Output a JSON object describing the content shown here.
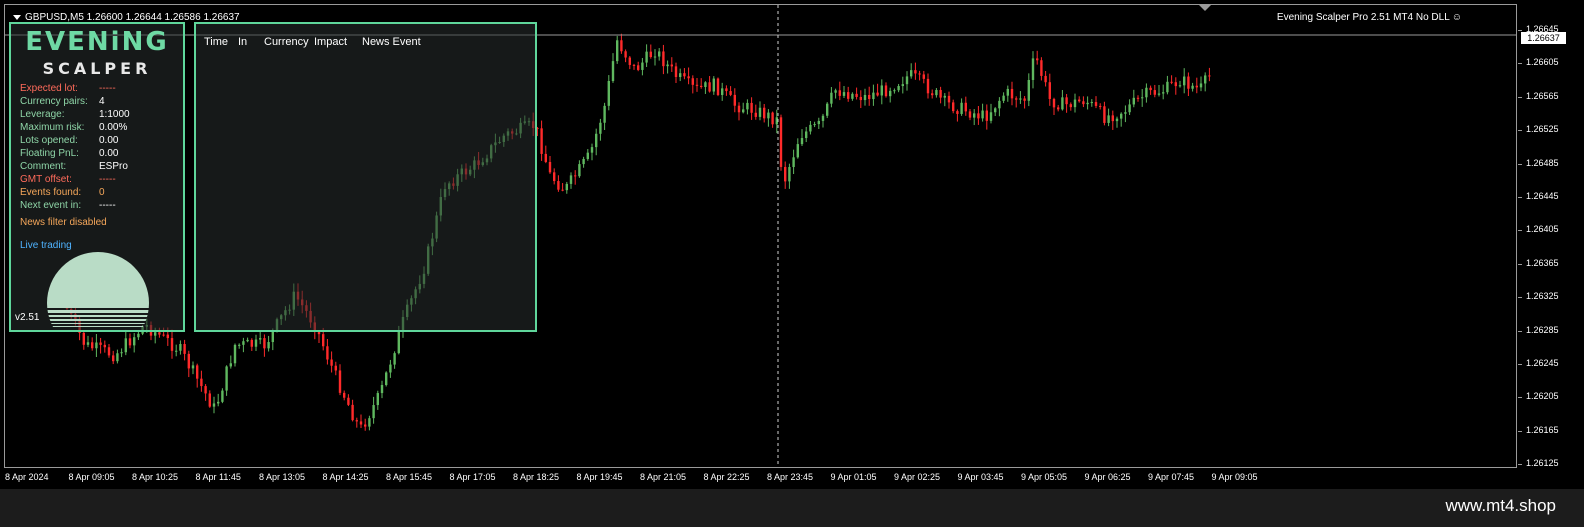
{
  "chart": {
    "symbol_info": "GBPUSD,M5  1.26600 1.26644 1.26586 1.26637",
    "ea_label": "Evening Scalper Pro 2.51 MT4 No DLL",
    "smiley": "☺",
    "current_price": "1.26637",
    "price_ticks": [
      "1.26645",
      "1.26605",
      "1.26565",
      "1.26525",
      "1.26485",
      "1.26445",
      "1.26405",
      "1.26365",
      "1.26325",
      "1.26285",
      "1.26245",
      "1.26205",
      "1.26165",
      "1.26125"
    ],
    "time_ticks": [
      "8 Apr 2024",
      "8 Apr 09:05",
      "8 Apr 10:25",
      "8 Apr 11:45",
      "8 Apr 13:05",
      "8 Apr 14:25",
      "8 Apr 15:45",
      "8 Apr 17:05",
      "8 Apr 18:25",
      "8 Apr 19:45",
      "8 Apr 21:05",
      "8 Apr 22:25",
      "8 Apr 23:45",
      "9 Apr 01:05",
      "9 Apr 02:25",
      "9 Apr 03:45",
      "9 Apr 05:05",
      "9 Apr 06:25",
      "9 Apr 07:45",
      "9 Apr 09:05"
    ],
    "colors": {
      "bull": "#5fb85f",
      "bear": "#ff2a2a",
      "grid_line": "#9a9a9a"
    }
  },
  "ea_panel": {
    "logo_top": "EVENiNG",
    "logo_bottom": "SCALPER",
    "rows": [
      {
        "label": "Expected lot:",
        "value": "-----"
      },
      {
        "label": "Currency pairs:",
        "value": "4"
      },
      {
        "label": "Leverage:",
        "value": "1:1000"
      },
      {
        "label": "Maximum risk:",
        "value": "0.00%"
      },
      {
        "label": "Lots opened:",
        "value": "0.00"
      },
      {
        "label": "Floating PnL:",
        "value": "0.00"
      },
      {
        "label": "Comment:",
        "value": "ESPro"
      },
      {
        "label": "GMT offset:",
        "value": "-----"
      },
      {
        "label": "Events found:",
        "value": "0"
      },
      {
        "label": "Next event in:",
        "value": "-----"
      }
    ],
    "news_filter": "News filter disabled",
    "trading_mode": "Live trading",
    "version": "v2.51",
    "accent": "#5fd69b"
  },
  "news_panel": {
    "columns": [
      "Time",
      "In",
      "Currency",
      "Impact",
      "News Event"
    ]
  },
  "watermark": "www.mt4.shop"
}
